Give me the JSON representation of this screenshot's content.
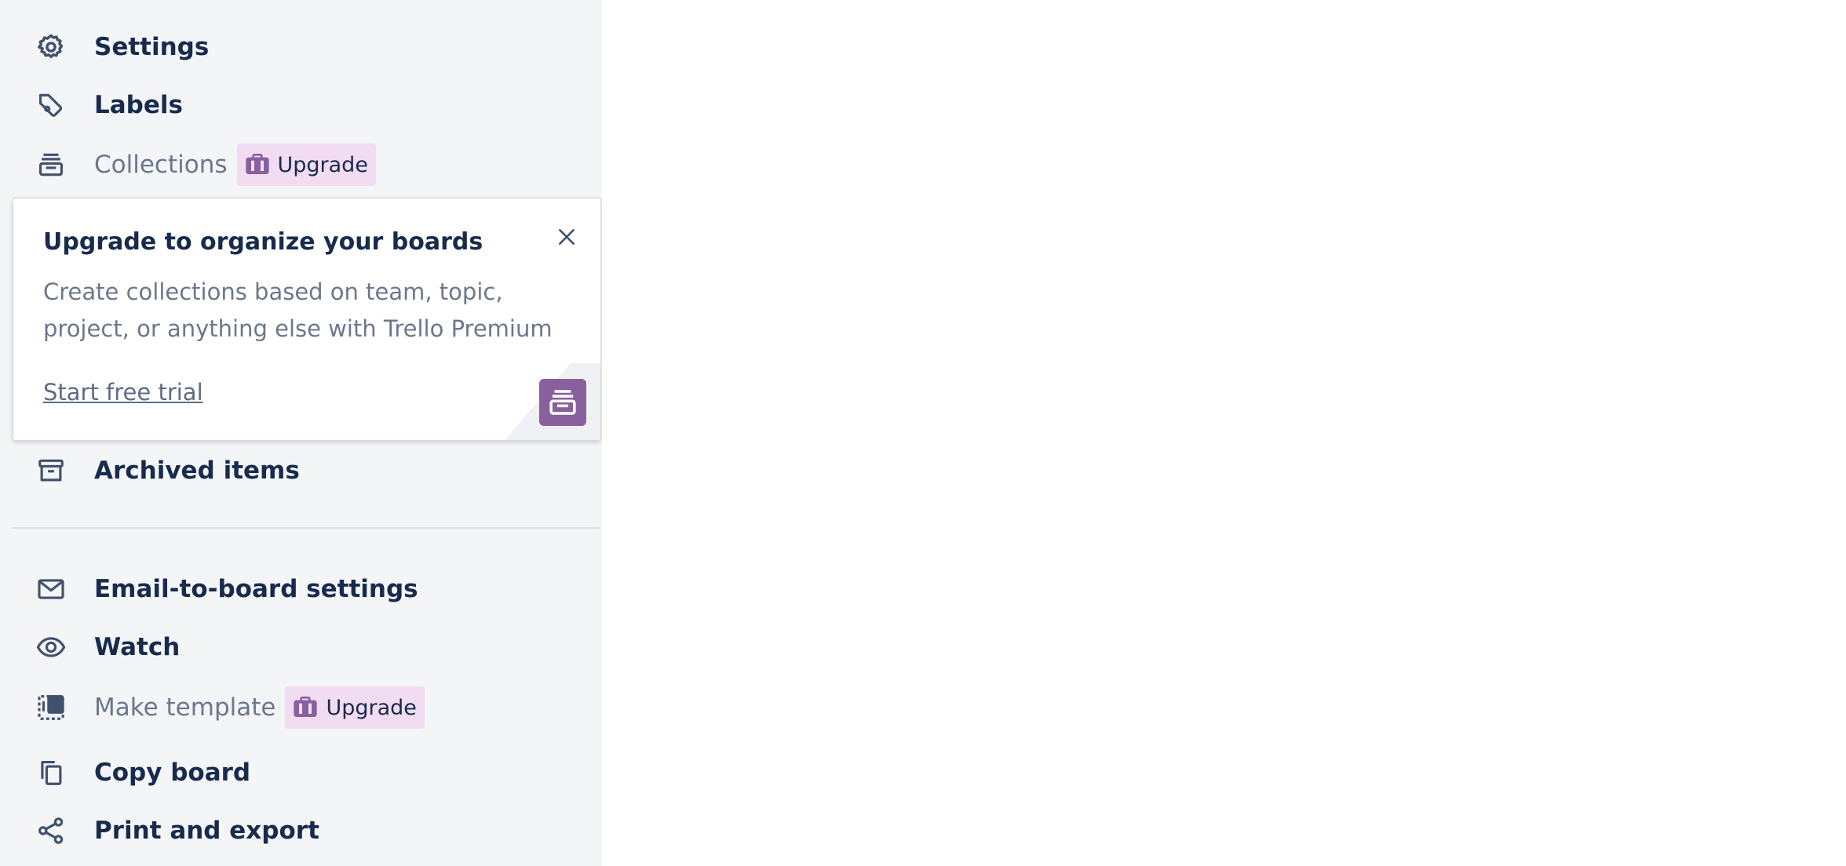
{
  "menu": {
    "settings": {
      "label": "Settings",
      "icon": "gear-icon"
    },
    "labels": {
      "label": "Labels",
      "icon": "tag-icon"
    },
    "collections": {
      "label": "Collections",
      "icon": "collections-icon",
      "badge": "Upgrade"
    },
    "archived": {
      "label": "Archived items",
      "icon": "archive-icon"
    },
    "email": {
      "label": "Email-to-board settings",
      "icon": "envelope-icon"
    },
    "watch": {
      "label": "Watch",
      "icon": "eye-icon"
    },
    "template": {
      "label": "Make template",
      "icon": "template-icon",
      "badge": "Upgrade"
    },
    "copy": {
      "label": "Copy board",
      "icon": "copy-icon"
    },
    "print": {
      "label": "Print and export",
      "icon": "share-icon"
    }
  },
  "popup": {
    "title": "Upgrade to organize your boards",
    "body": "Create collections based on team, topic, project, or anything else with Trello Premium",
    "cta": "Start free trial"
  },
  "colors": {
    "sidebar_bg": "#f4f5f7",
    "text_primary": "#172b4d",
    "text_muted": "#6b778c",
    "badge_bg": "#f2dcf2",
    "premium_purple": "#89609e"
  }
}
